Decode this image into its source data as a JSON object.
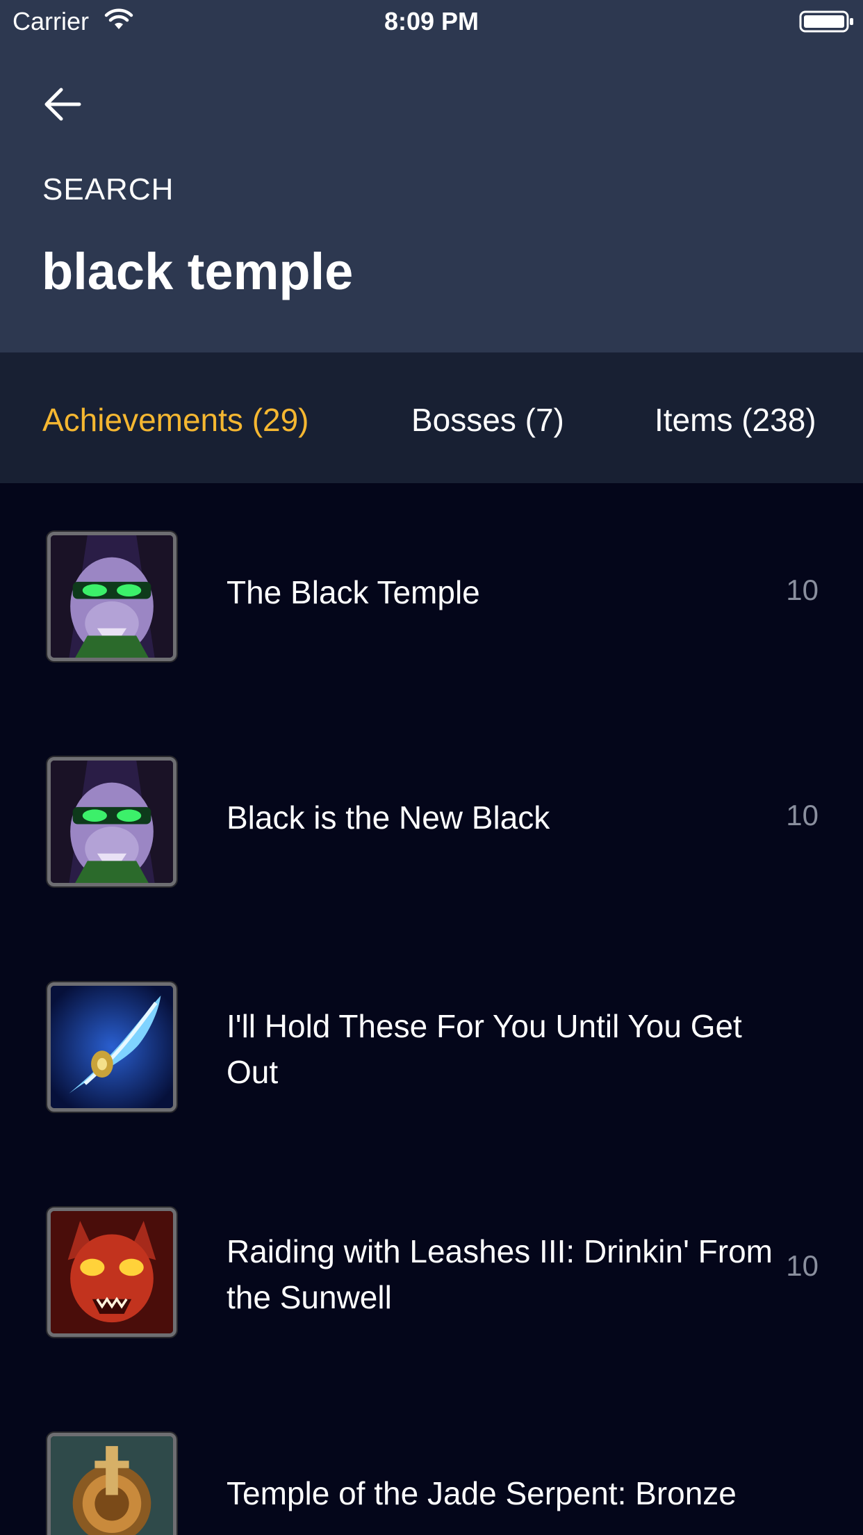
{
  "status_bar": {
    "carrier": "Carrier",
    "time": "8:09 PM"
  },
  "header": {
    "section_label": "SEARCH",
    "query": "black temple",
    "back_icon": "arrow-left-icon"
  },
  "tabs": [
    {
      "label": "Achievements (29)",
      "active": true
    },
    {
      "label": "Bosses (7)",
      "active": false
    },
    {
      "label": "Items (238)",
      "active": false
    }
  ],
  "results": [
    {
      "title": "The Black Temple",
      "points": "10",
      "icon": "illidan-portrait-icon"
    },
    {
      "title": "Black is the New Black",
      "points": "10",
      "icon": "illidan-portrait-icon"
    },
    {
      "title": "I'll Hold These For You Until You Get Out",
      "points": "",
      "icon": "warglaive-icon"
    },
    {
      "title": "Raiding with Leashes III: Drinkin' From the Sunwell",
      "points": "10",
      "icon": "red-demon-pet-icon"
    },
    {
      "title": "Temple of the Jade Serpent: Bronze",
      "points": "",
      "icon": "bronze-medal-shield-icon"
    }
  ],
  "colors": {
    "header_bg": "#2d3850",
    "tabs_bg": "#182033",
    "list_bg": "#04061a",
    "active_tab": "#f5b731",
    "points": "#8a8f9e"
  }
}
